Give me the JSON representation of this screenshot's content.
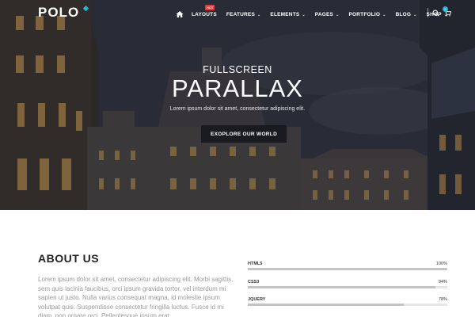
{
  "nav": {
    "logo": "POLO",
    "hot_badge": "HOT",
    "items": [
      {
        "label": "LAYOUTS"
      },
      {
        "label": "FEATURES"
      },
      {
        "label": "ELEMENTS"
      },
      {
        "label": "PAGES"
      },
      {
        "label": "PORTFOLIO"
      },
      {
        "label": "BLOG"
      },
      {
        "label": "SHOP"
      }
    ],
    "cart_count": "0",
    "colors": {
      "accent": "#1fb6d8",
      "badge": "#e23b3b"
    }
  },
  "hero": {
    "subtitle": "FULLSCREEN",
    "title": "PARALLAX",
    "text": "Lorem ipsum dolor sit amet, consectetur adipiscing elit.",
    "button_label": "EXOPLORE OUR WORLD"
  },
  "about": {
    "title": "ABOUT US",
    "text": "Lorem ipsum dolor sit amet, consectetur adipiscing elit. Morbi sagittis, sem quis lacinia faucibus, orci ipsum gravida tortor, vel interdum mi sapien ut justo. Nulla varius consequat magna, id molestie ipsum volutpat quis. Suspendisse consectetur fringilla luctus. Fusce id mi diam, non ornare orci. Pellentesque ipsum erat"
  },
  "skills": [
    {
      "label": "HTML5",
      "pct_label": "100%",
      "value": 1.0
    },
    {
      "label": "CSS3",
      "pct_label": "94%",
      "value": 0.94
    },
    {
      "label": "JQUERY",
      "pct_label": "78%",
      "value": 0.78
    }
  ]
}
